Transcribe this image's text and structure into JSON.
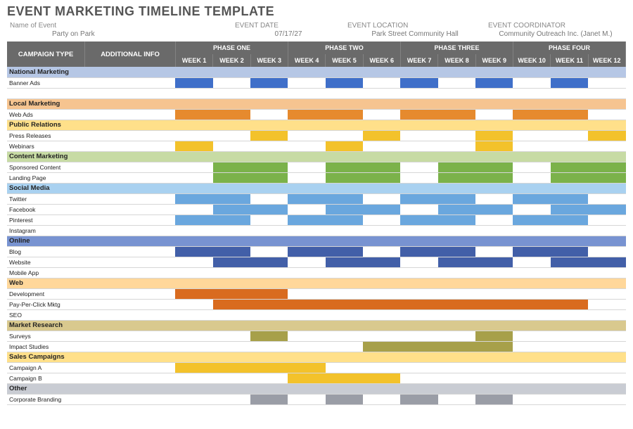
{
  "title": "EVENT MARKETING TIMELINE TEMPLATE",
  "meta": {
    "name_lbl": "Name of Event",
    "name_val": "Party on Park",
    "date_lbl": "EVENT DATE",
    "date_val": "07/17/27",
    "loc_lbl": "EVENT LOCATION",
    "loc_val": "Park Street Community Hall",
    "coord_lbl": "EVENT COORDINATOR",
    "coord_val": "Community Outreach Inc. (Janet M.)"
  },
  "headers": {
    "campaign_type": "CAMPAIGN TYPE",
    "additional_info": "ADDITIONAL INFO",
    "phases": [
      "PHASE ONE",
      "PHASE TWO",
      "PHASE THREE",
      "PHASE FOUR"
    ],
    "weeks": [
      "WEEK 1",
      "WEEK 2",
      "WEEK 3",
      "WEEK 4",
      "WEEK 5",
      "WEEK 6",
      "WEEK 7",
      "WEEK 8",
      "WEEK 9",
      "WEEK 10",
      "WEEK 11",
      "WEEK 12"
    ]
  },
  "groups": [
    {
      "name": "National Marketing",
      "cls": "c-nat",
      "sub": false,
      "color": "b-blu",
      "rows": [
        {
          "name": "Banner Ads",
          "bars": [
            1,
            3,
            5,
            7,
            9,
            11
          ]
        },
        {
          "name": "",
          "bars": []
        }
      ]
    },
    {
      "name": "Local Marketing",
      "cls": "c-loc",
      "sub": false,
      "color": "b-org",
      "rows": [
        {
          "name": "Web Ads",
          "bars": [
            1,
            2,
            4,
            5,
            7,
            8,
            10,
            11
          ]
        }
      ]
    },
    {
      "name": "Public Relations",
      "cls": "c-pub",
      "sub": true,
      "color": "b-yel",
      "rows": [
        {
          "name": "Press Releases",
          "bars": [
            3,
            6,
            9,
            12
          ]
        },
        {
          "name": "Webinars",
          "bars": [
            1,
            5,
            9
          ]
        }
      ]
    },
    {
      "name": "Content Marketing",
      "cls": "c-con",
      "sub": false,
      "color": "b-grn",
      "rows": [
        {
          "name": "Sponsored Content",
          "bars": [
            2,
            3,
            5,
            6,
            8,
            9,
            11,
            12
          ]
        },
        {
          "name": "Landing Page",
          "bars": [
            2,
            3,
            5,
            6,
            8,
            9,
            11,
            12
          ]
        }
      ]
    },
    {
      "name": "Social Media",
      "cls": "c-soc",
      "sub": true,
      "color": "b-lbl",
      "rows": [
        {
          "name": "Twitter",
          "bars": [
            1,
            2,
            4,
            5,
            7,
            8,
            10,
            11
          ]
        },
        {
          "name": "Facebook",
          "bars": [
            2,
            3,
            5,
            6,
            8,
            9,
            11,
            12
          ]
        },
        {
          "name": "Pinterest",
          "bars": [
            1,
            2,
            4,
            5,
            7,
            8,
            10,
            11
          ]
        },
        {
          "name": "Instagram",
          "bars": []
        }
      ]
    },
    {
      "name": "Online",
      "cls": "c-onl",
      "sub": true,
      "color": "b-dbl",
      "rows": [
        {
          "name": "Blog",
          "bars": [
            1,
            2,
            4,
            5,
            7,
            8,
            10,
            11
          ]
        },
        {
          "name": "Website",
          "bars": [
            2,
            3,
            5,
            6,
            8,
            9,
            11,
            12
          ]
        },
        {
          "name": "Mobile App",
          "bars": []
        }
      ]
    },
    {
      "name": "Web",
      "cls": "c-web",
      "sub": true,
      "color": "b-dor",
      "rows": [
        {
          "name": "Development",
          "bars": [
            1,
            2,
            3
          ]
        },
        {
          "name": "Pay-Per-Click Mktg",
          "bars": [
            2,
            3,
            4,
            5,
            6,
            7,
            8,
            9,
            10,
            11
          ]
        },
        {
          "name": "SEO",
          "bars": []
        }
      ]
    },
    {
      "name": "Market Research",
      "cls": "c-mkr",
      "sub": true,
      "color": "b-oli",
      "rows": [
        {
          "name": "Surveys",
          "bars": [
            3,
            9
          ]
        },
        {
          "name": "Impact Studies",
          "bars": [
            6,
            7,
            8,
            9
          ]
        }
      ]
    },
    {
      "name": "Sales Campaigns",
      "cls": "c-sal",
      "sub": false,
      "color": "b-yel",
      "rows": [
        {
          "name": "Campaign A",
          "bars": [
            1,
            2,
            3,
            4
          ]
        },
        {
          "name": "Campaign B",
          "bars": [
            4,
            5,
            6
          ]
        }
      ]
    },
    {
      "name": "Other",
      "cls": "c-oth",
      "sub": true,
      "color": "b-gry",
      "rows": [
        {
          "name": "Corporate Branding",
          "bars": [
            3,
            5,
            7,
            9
          ]
        }
      ]
    }
  ]
}
